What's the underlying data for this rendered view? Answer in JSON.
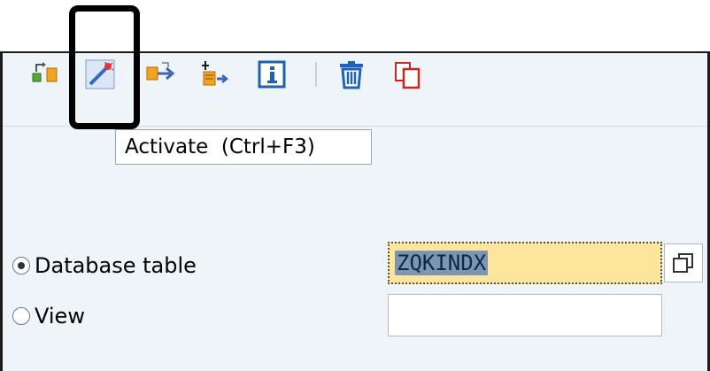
{
  "toolbar": {
    "icons": [
      "display-change-icon",
      "activate-icon",
      "where-used-icon",
      "object-list-icon",
      "info-icon",
      "delete-icon",
      "copy-icon"
    ]
  },
  "tooltip": {
    "text": "Activate  (Ctrl+F3)"
  },
  "form": {
    "database_table_label": "Database table",
    "view_label": "View",
    "database_table_value": "ZQKINDX",
    "view_value": "",
    "selected_option": "Database table"
  },
  "colors": {
    "frame_bg": "#eff4f9",
    "required_field_bg": "#fde69b",
    "selection_bg": "#7c95b4"
  }
}
